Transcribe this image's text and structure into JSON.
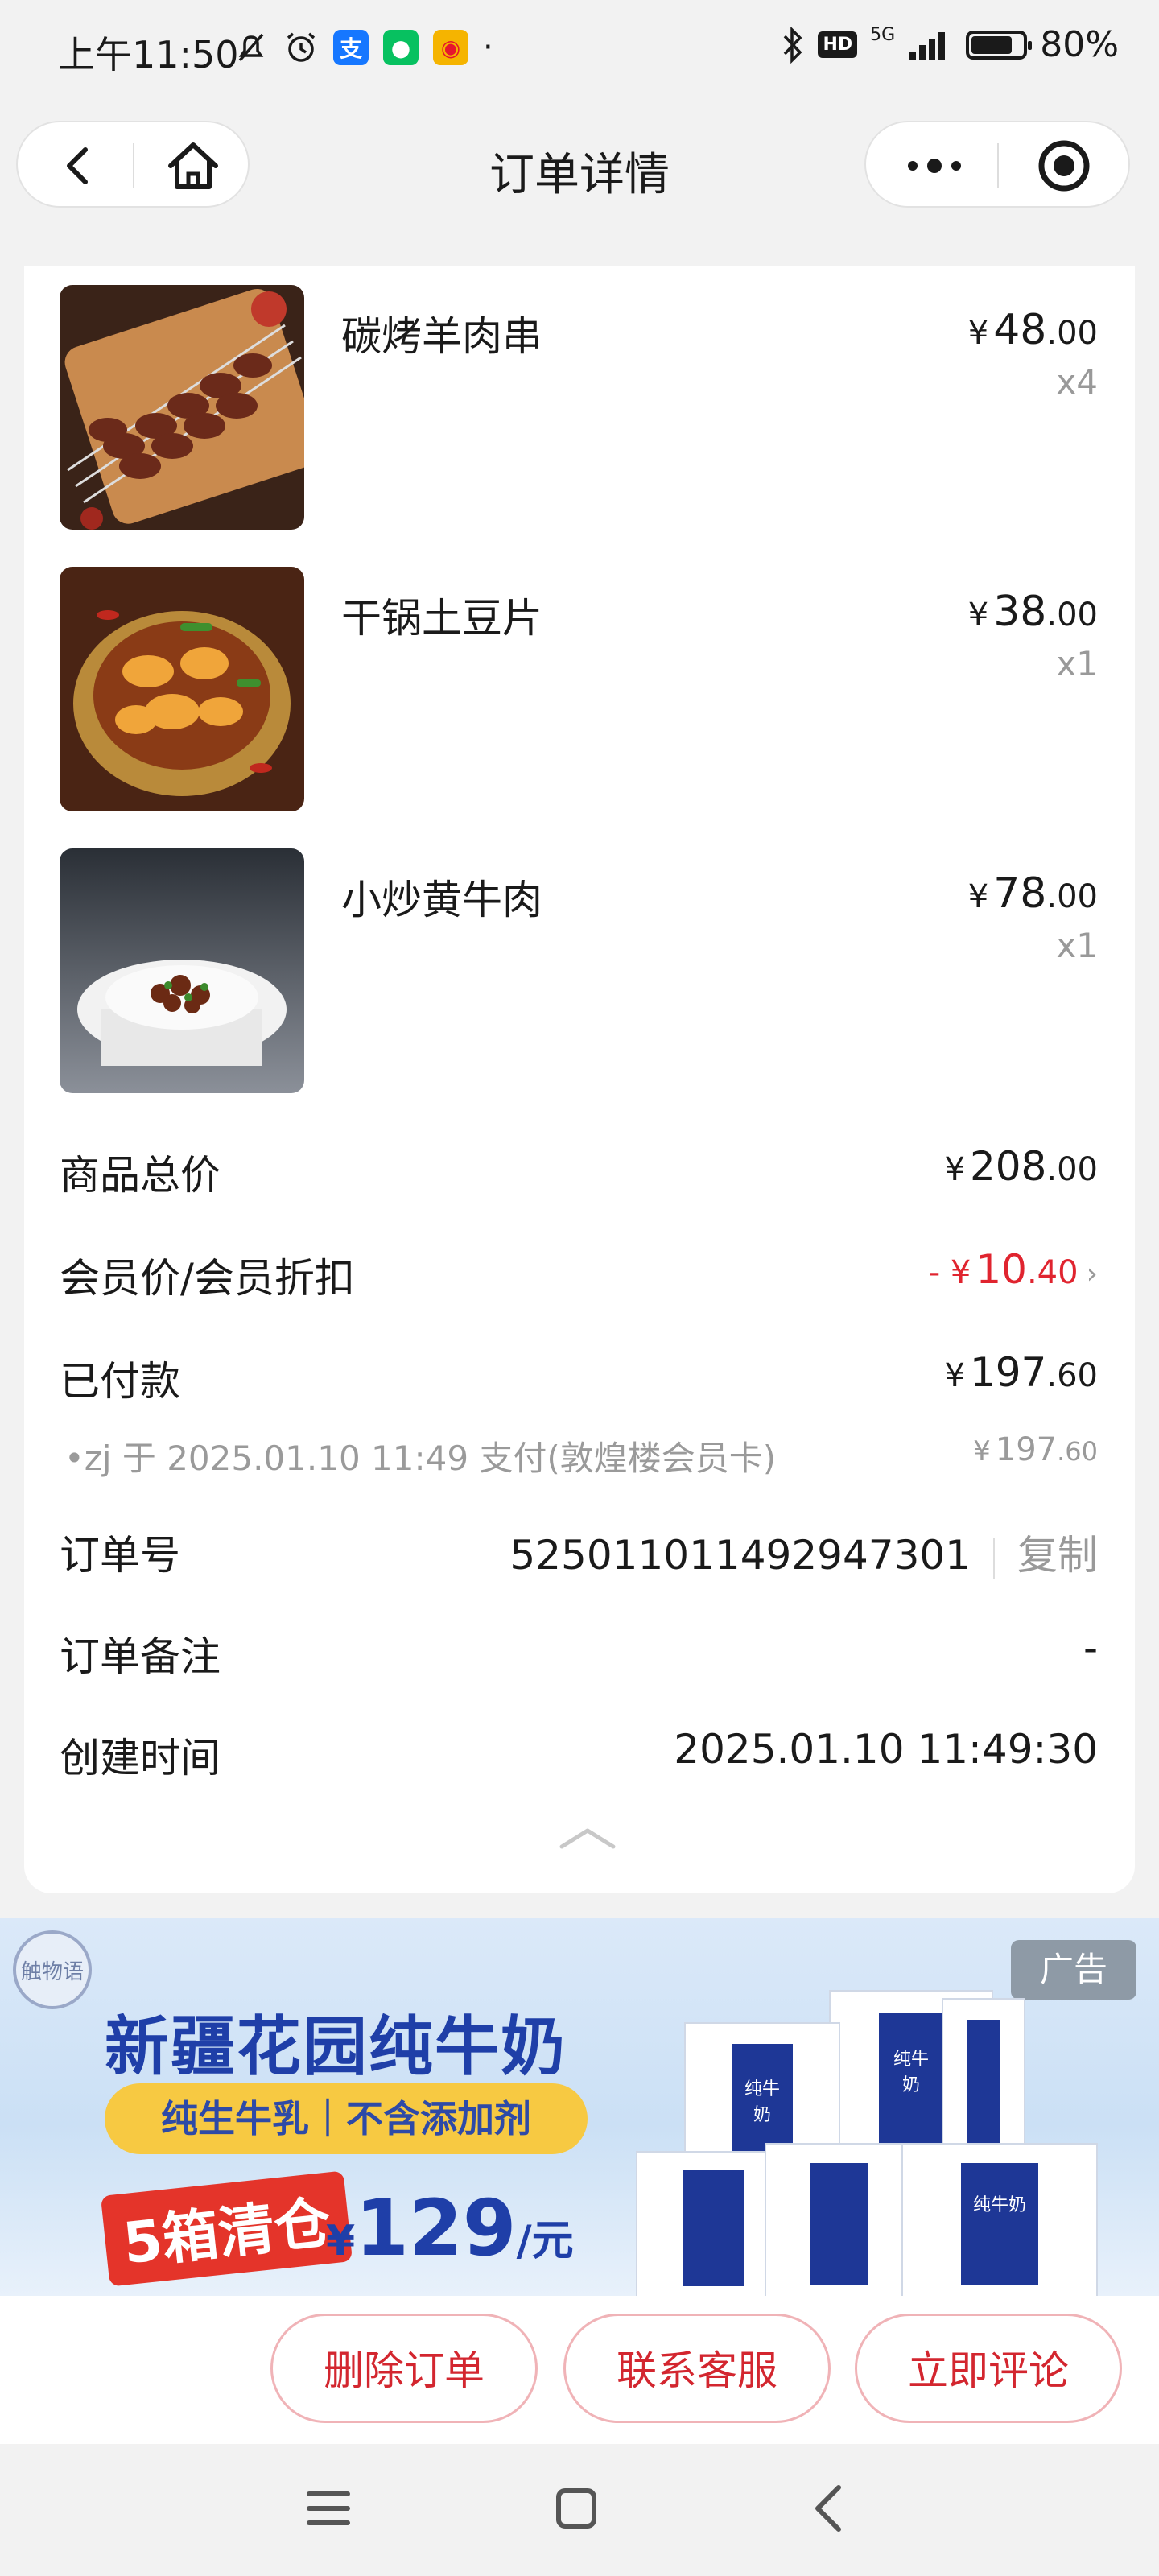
{
  "status": {
    "time": "上午11:50",
    "network": "5G",
    "hd": "HD",
    "battery_percent": "80%",
    "battery_level": 0.8,
    "app_icons": [
      "mute-bell-icon",
      "alarm-icon",
      "alipay-icon",
      "wechat-icon",
      "weibo-icon"
    ],
    "dot": "·"
  },
  "nav": {
    "title": "订单详情"
  },
  "items": [
    {
      "name": "碳烤羊肉串",
      "currency": "¥",
      "price_int": "48",
      "price_dec": ".00",
      "qty": "x4",
      "image": "lamb-skewers-photo"
    },
    {
      "name": "干锅土豆片",
      "currency": "¥",
      "price_int": "38",
      "price_dec": ".00",
      "qty": "x1",
      "image": "dry-pot-potato-photo"
    },
    {
      "name": "小炒黄牛肉",
      "currency": "¥",
      "price_int": "78",
      "price_dec": ".00",
      "qty": "x1",
      "image": "stir-fried-beef-photo"
    }
  ],
  "summary": {
    "total_label": "商品总价",
    "total_currency": "¥",
    "total_int": "208",
    "total_dec": ".00",
    "discount_label": "会员价/会员折扣",
    "discount_prefix": "- ¥",
    "discount_int": "10",
    "discount_dec": ".40",
    "paid_label": "已付款",
    "paid_currency": "¥",
    "paid_int": "197",
    "paid_dec": ".60",
    "payment_detail": "•zj 于 2025.01.10 11:49 支付(敦煌楼会员卡)",
    "payment_currency": "¥",
    "payment_int": "197",
    "payment_dec": ".60",
    "order_no_label": "订单号",
    "order_no": "525011011492947301",
    "copy_label": "复制",
    "remark_label": "订单备注",
    "remark_value": "-",
    "created_label": "创建时间",
    "created_value": "2025.01.10 11:49:30"
  },
  "ad": {
    "badge": "广告",
    "logo_text": "触物语",
    "title": "新疆花园纯牛奶",
    "pill": "纯生牛乳｜不含添加剂",
    "promo": "5箱清仓",
    "price_currency": "¥",
    "price": "129",
    "price_unit": "/元",
    "box_label": "纯牛奶"
  },
  "actions": {
    "delete": "删除订单",
    "contact": "联系客服",
    "review": "立即评论"
  },
  "colors": {
    "accent_red": "#e0242f",
    "ad_blue": "#1f3fa8"
  }
}
